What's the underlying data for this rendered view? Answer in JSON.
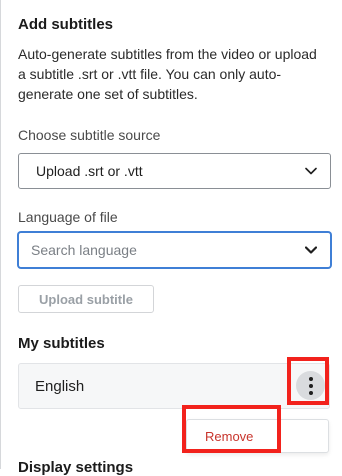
{
  "add_subtitles": {
    "title": "Add subtitles",
    "description": "Auto-generate subtitles from the video or upload a subtitle .srt or .vtt file. You can only auto-generate one set of subtitles."
  },
  "source": {
    "label": "Choose subtitle source",
    "selected": "Upload .srt or .vtt"
  },
  "language": {
    "label": "Language of file",
    "placeholder": "Search language"
  },
  "upload_button": "Upload subtitle",
  "my_subtitles": {
    "title": "My subtitles",
    "items": [
      {
        "language": "English"
      }
    ]
  },
  "context_menu": {
    "items": [
      "Remove"
    ]
  },
  "display_settings": {
    "title": "Display settings"
  },
  "colors": {
    "highlight": "#f2221c",
    "focus": "#3f7fd6",
    "danger": "#c8342c"
  },
  "icons": {
    "dropdown": "chevron-down-icon",
    "more": "more-vertical-icon"
  }
}
